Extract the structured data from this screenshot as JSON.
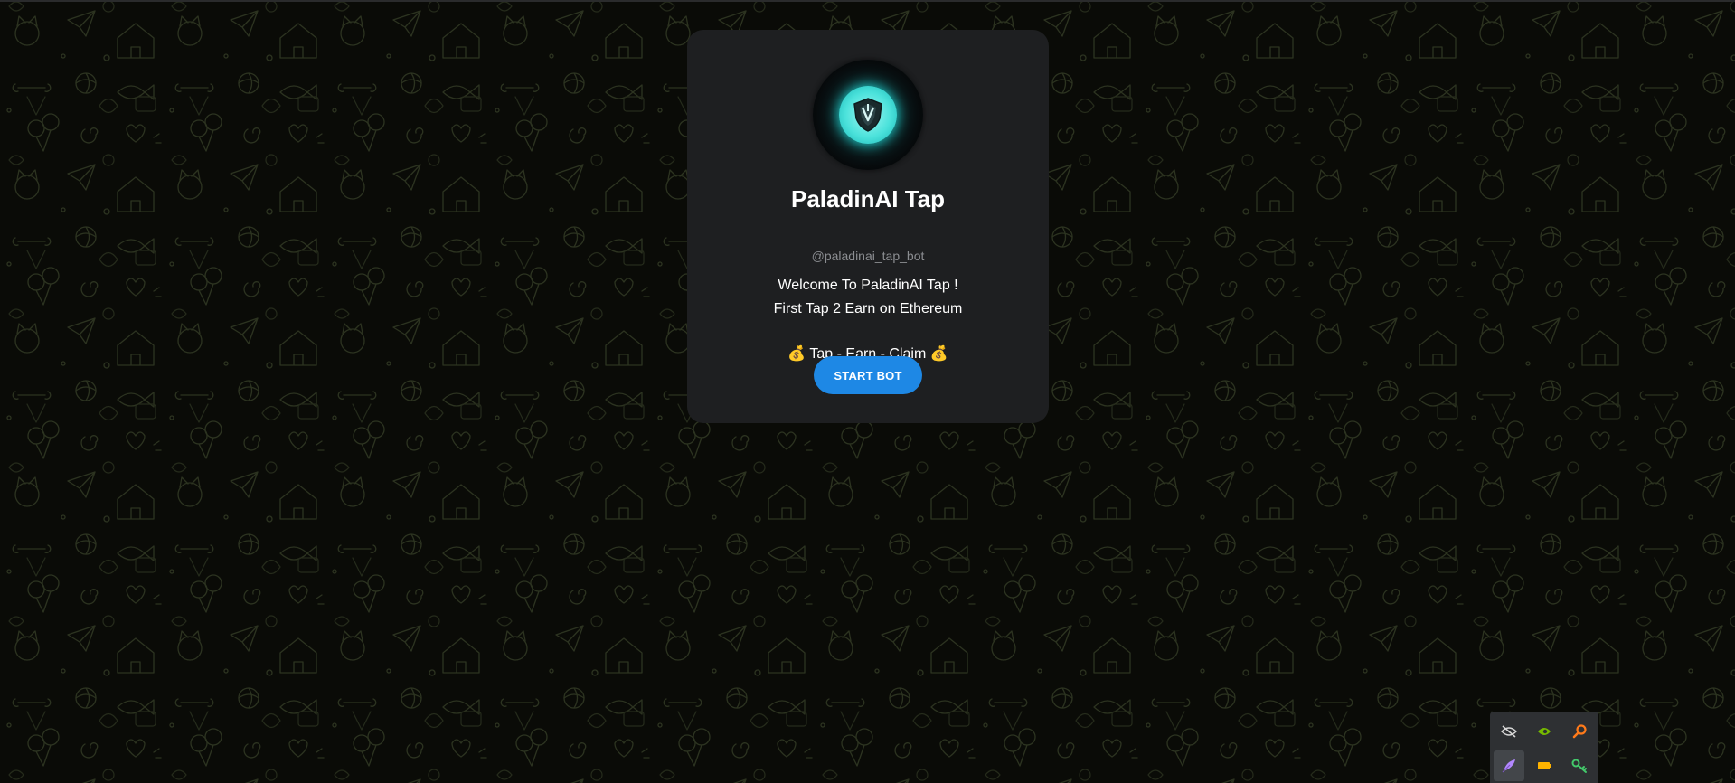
{
  "bot": {
    "name": "PaladinAI Tap",
    "handle": "@paladinai_tap_bot",
    "description_line1": "Welcome To PaladinAI Tap !",
    "description_line2": "First Tap 2 Earn on Ethereum",
    "tagline": "💰 Tap - Earn - Claim 💰",
    "avatar_icon": "shield-logo-icon"
  },
  "start_button": {
    "label": "START BOT"
  },
  "tray": {
    "icons": [
      "hidden-eye-icon",
      "nvidia-icon",
      "search-icon",
      "feather-icon",
      "battery-icon",
      "key-icon"
    ]
  },
  "colors": {
    "background": "#0a0b07",
    "card": "#1e1f21",
    "accent": "#1e88e5",
    "avatar_glow": "#4be2db"
  }
}
